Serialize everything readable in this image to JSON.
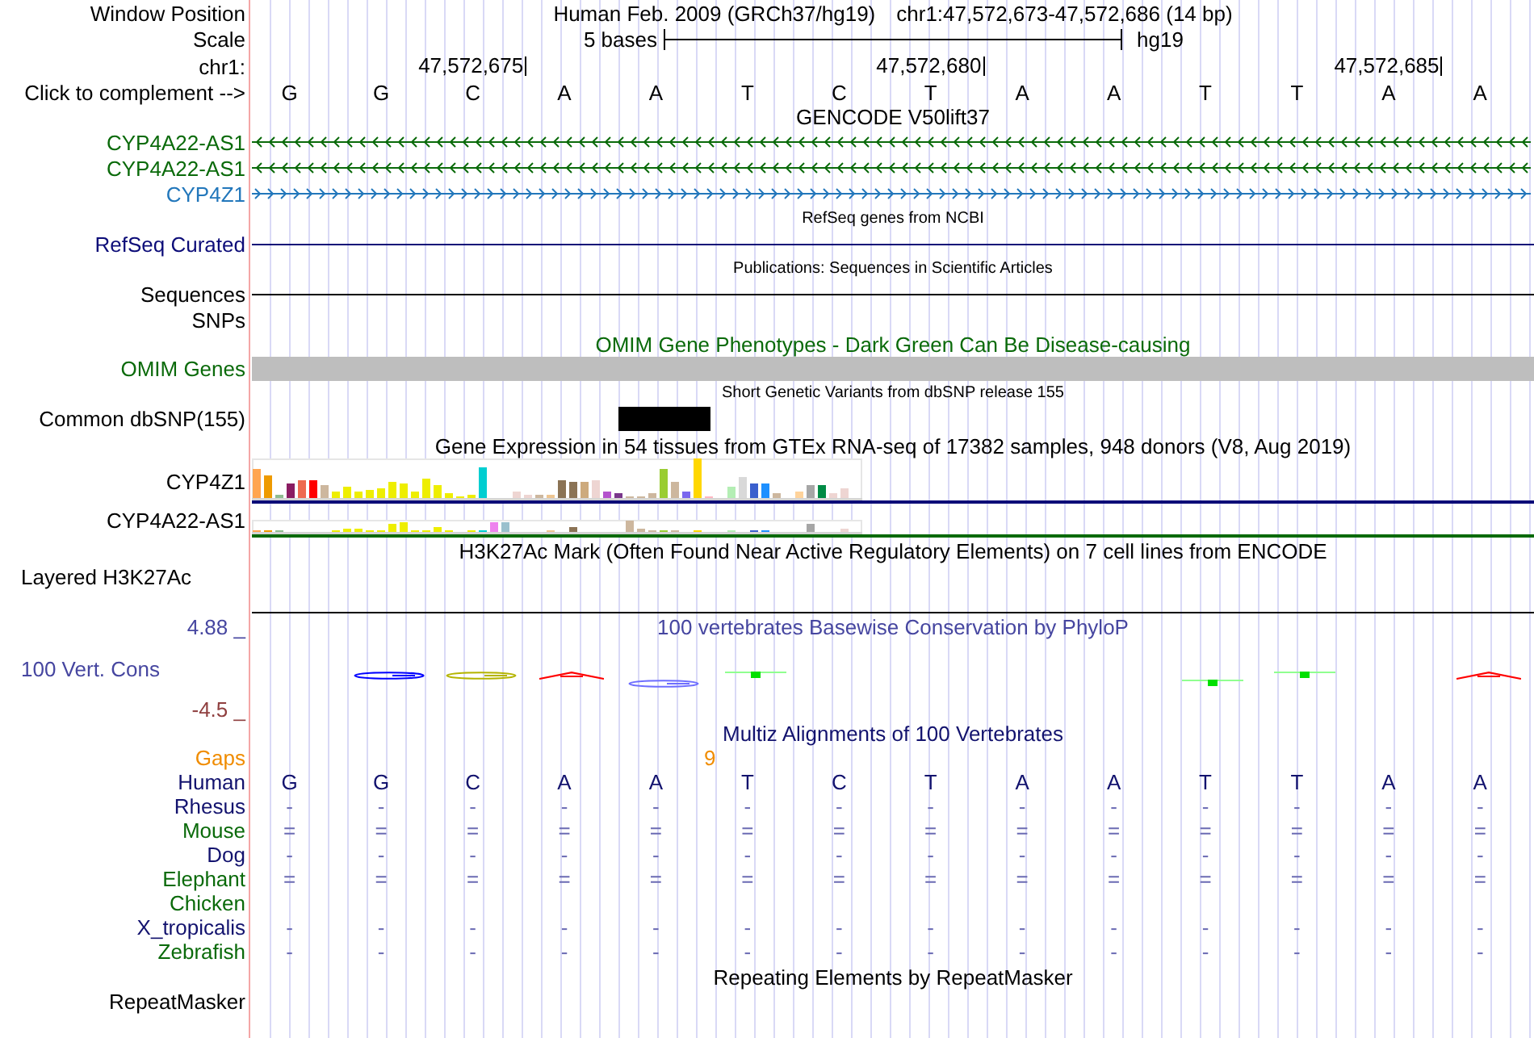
{
  "position": {
    "label": "Window Position",
    "assembly": "Human Feb. 2009 (GRCh37/hg19)",
    "range": "chr1:47,572,673-47,572,686 (14 bp)"
  },
  "scale": {
    "label": "Scale",
    "span": "5 bases",
    "assembly": "hg19"
  },
  "ruler": {
    "label": "chr1:",
    "ticks": [
      "47,572,675",
      "47,572,680",
      "47,572,685"
    ]
  },
  "sequence": {
    "label": "Click to complement -->",
    "bases": [
      "G",
      "G",
      "C",
      "A",
      "A",
      "T",
      "C",
      "T",
      "A",
      "A",
      "T",
      "T",
      "A",
      "A"
    ]
  },
  "tracks": [
    {
      "kind": "genes",
      "title": "GENCODE V50lift37",
      "color": "#000000",
      "rows": [
        {
          "label": "CYP4A22-AS1",
          "color": "#0a6a0a",
          "reverse": true
        },
        {
          "label": "CYP4A22-AS1",
          "color": "#0a6a0a",
          "reverse": true
        },
        {
          "label": "CYP4Z1",
          "color": "#2277bb",
          "reverse": false
        }
      ]
    },
    {
      "kind": "bed",
      "title": "RefSeq genes from NCBI",
      "color": "#000000",
      "rows": [
        {
          "label": "RefSeq Curated",
          "color": "#0c0c78",
          "feature": true
        }
      ]
    },
    {
      "kind": "bed",
      "title": "Publications: Sequences in Scientific Articles",
      "color": "#000000",
      "rows": [
        {
          "label": "Sequences",
          "color": "#000000",
          "feature": true
        },
        {
          "label": "SNPs",
          "color": "#000000",
          "feature": false
        }
      ]
    },
    {
      "kind": "omim",
      "title": "OMIM Gene Phenotypes - Dark Green Can Be Disease-causing",
      "color": "#0a6a0a",
      "rows": [
        {
          "label": "OMIM Genes",
          "color": "#0a6a0a"
        }
      ]
    },
    {
      "kind": "snp",
      "title": "Short Genetic Variants from dbSNP release 155",
      "color": "#000000",
      "rows": [
        {
          "label": "Common dbSNP(155)",
          "color": "#000000"
        }
      ]
    },
    {
      "kind": "expression",
      "title": "Gene Expression in 54 tissues from GTEx RNA-seq of 17382 samples, 948 donors (V8, Aug 2019)",
      "color": "#000000",
      "rows": [
        {
          "label": "CYP4Z1",
          "color": "#0c0c78"
        },
        {
          "label": "CYP4A22-AS1",
          "color": "#0a6a0a"
        }
      ]
    },
    {
      "kind": "layered",
      "title": "H3K27Ac Mark (Often Found Near Active Regulatory Elements) on 7 cell lines from ENCODE",
      "color": "#000000",
      "rows": [
        {
          "label": "Layered H3K27Ac",
          "color": "#000000"
        }
      ]
    },
    {
      "kind": "wiggle",
      "title": "100 vertebrates Basewise Conservation by PhyloP",
      "color": "#4646a0",
      "rows": [
        {
          "kind": "max",
          "label": "4.88 _",
          "color": "#4646a0"
        },
        {
          "kind": "name",
          "label": "100 Vert. Cons",
          "color": "#4646a0"
        },
        {
          "kind": "min",
          "label": "-4.5 _",
          "color": "#8f3f3f"
        }
      ]
    },
    {
      "kind": "alignment",
      "title": "Multiz Alignments of 100 Vertebrates",
      "color": "#12126e",
      "rows": [
        {
          "kind": "gaps",
          "label": "Gaps",
          "color": "#f08c00",
          "gap": "9"
        },
        {
          "kind": "bases",
          "label": "Human",
          "color": "#12126e",
          "cells": [
            "G",
            "G",
            "C",
            "A",
            "A",
            "T",
            "C",
            "T",
            "A",
            "A",
            "T",
            "T",
            "A",
            "A"
          ]
        },
        {
          "kind": "symbols",
          "label": "Rhesus",
          "color": "#12126e",
          "cells": [
            "-",
            "-",
            "-",
            "-",
            "-",
            "-",
            "-",
            "-",
            "-",
            "-",
            "-",
            "-",
            "-",
            "-"
          ]
        },
        {
          "kind": "symbols",
          "label": "Mouse",
          "color": "#0a6a0a",
          "cells": [
            "=",
            "=",
            "=",
            "=",
            "=",
            "=",
            "=",
            "=",
            "=",
            "=",
            "=",
            "=",
            "=",
            "="
          ]
        },
        {
          "kind": "symbols",
          "label": "Dog",
          "color": "#12126e",
          "cells": [
            "-",
            "-",
            "-",
            "-",
            "-",
            "-",
            "-",
            "-",
            "-",
            "-",
            "-",
            "-",
            "-",
            "-"
          ]
        },
        {
          "kind": "symbols",
          "label": "Elephant",
          "color": "#0a6a0a",
          "cells": [
            "=",
            "=",
            "=",
            "=",
            "=",
            "=",
            "=",
            "=",
            "=",
            "=",
            "=",
            "=",
            "=",
            "="
          ]
        },
        {
          "kind": "symbols",
          "label": "Chicken",
          "color": "#0a6a0a"
        },
        {
          "kind": "symbols",
          "label": "X_tropicalis",
          "color": "#12126e",
          "cells": [
            "-",
            "-",
            "-",
            "-",
            "-",
            "-",
            "-",
            "-",
            "-",
            "-",
            "-",
            "-",
            "-",
            "-"
          ]
        },
        {
          "kind": "symbols",
          "label": "Zebrafish",
          "color": "#0a6a0a",
          "cells": [
            "-",
            "-",
            "-",
            "-",
            "-",
            "-",
            "-",
            "-",
            "-",
            "-",
            "-",
            "-",
            "-",
            "-"
          ]
        }
      ]
    },
    {
      "kind": "repeat",
      "title": "Repeating Elements by RepeatMasker",
      "color": "#000000",
      "rows": [
        {
          "label": "RepeatMasker",
          "color": "#000000"
        }
      ]
    }
  ]
}
